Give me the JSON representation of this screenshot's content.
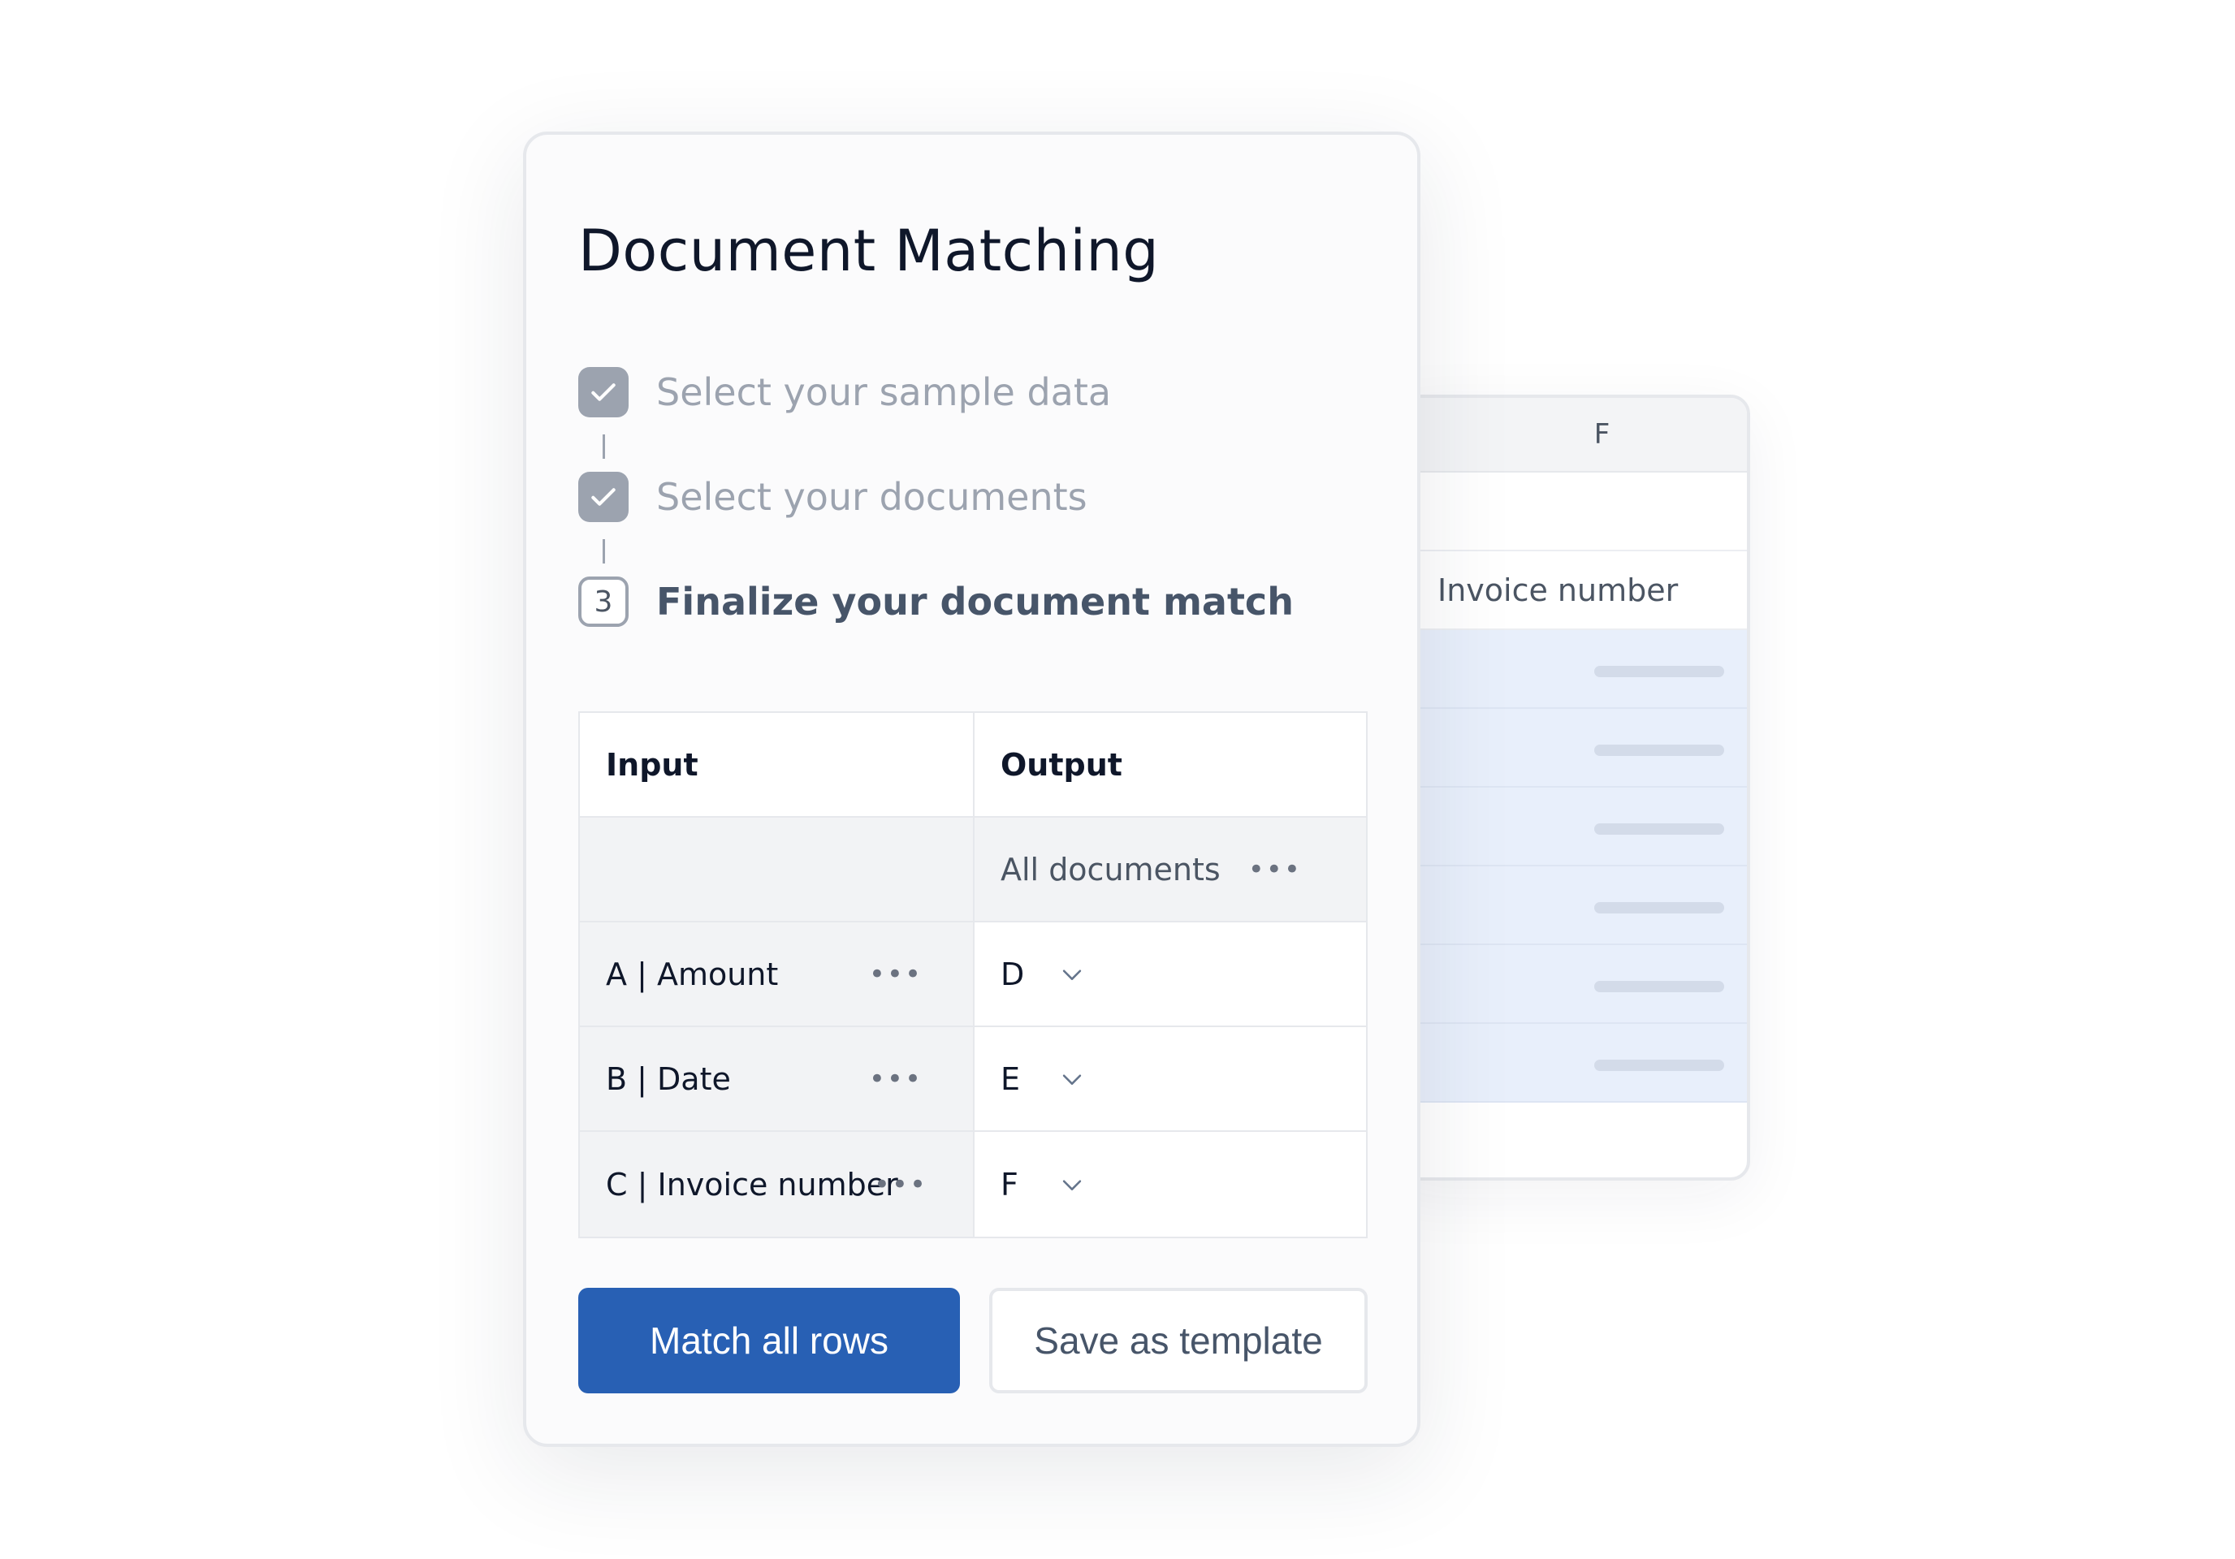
{
  "card": {
    "title": "Document Matching",
    "steps": [
      {
        "label": "Select your sample data",
        "status": "done",
        "icon": "check-icon"
      },
      {
        "label": "Select your documents",
        "status": "done",
        "icon": "check-icon"
      },
      {
        "label": "Finalize your document match",
        "status": "current",
        "number": "3"
      }
    ],
    "table": {
      "headers": {
        "input": "Input",
        "output": "Output"
      },
      "all_docs_label": "All documents",
      "rows": [
        {
          "input": "A | Amount",
          "output": "D"
        },
        {
          "input": "B | Date",
          "output": "E"
        },
        {
          "input": "C | Invoice number",
          "output": "F"
        }
      ]
    },
    "buttons": {
      "primary": "Match all rows",
      "secondary": "Save as template"
    }
  },
  "sheet": {
    "column_letter": "F",
    "header_label": "Invoice number"
  },
  "colors": {
    "primary": "#2860b4",
    "muted": "#9ca3af",
    "highlight": "#e8effb"
  }
}
